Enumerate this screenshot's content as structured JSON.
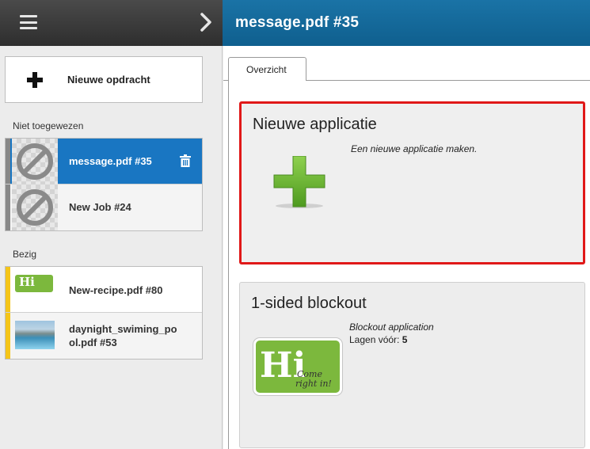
{
  "header": {
    "title": "message.pdf #35"
  },
  "sidebar": {
    "new_job_label": "Nieuwe opdracht",
    "sections": {
      "unassigned": {
        "label": "Niet toegewezen",
        "jobs": [
          {
            "label": "message.pdf #35",
            "selected": true
          },
          {
            "label": "New Job #24",
            "selected": false
          }
        ]
      },
      "busy": {
        "label": "Bezig",
        "jobs": [
          {
            "label": "New-recipe.pdf #80",
            "thumb_text": "Hi"
          },
          {
            "label_line1": "daynight_swiming_po",
            "label_line2": "ol.pdf #53"
          }
        ]
      }
    }
  },
  "tabs": [
    {
      "label": "Overzicht",
      "active": true
    }
  ],
  "cards": [
    {
      "title": "Nieuwe applicatie",
      "description": "Een nieuwe applicatie maken.",
      "highlighted": true
    },
    {
      "title": "1-sided blockout",
      "description": "Blockout application",
      "layers_label": "Lagen vóór:",
      "layers_value": "5",
      "logo_text": "Hi",
      "logo_script_1": "Come",
      "logo_script_2": "right in!"
    }
  ],
  "colors": {
    "accent_blue": "#1976c2",
    "header_blue": "#0f5f8e",
    "highlight_red": "#e01818",
    "stripe_yellow": "#f5c518",
    "brand_green": "#7cb83d"
  }
}
